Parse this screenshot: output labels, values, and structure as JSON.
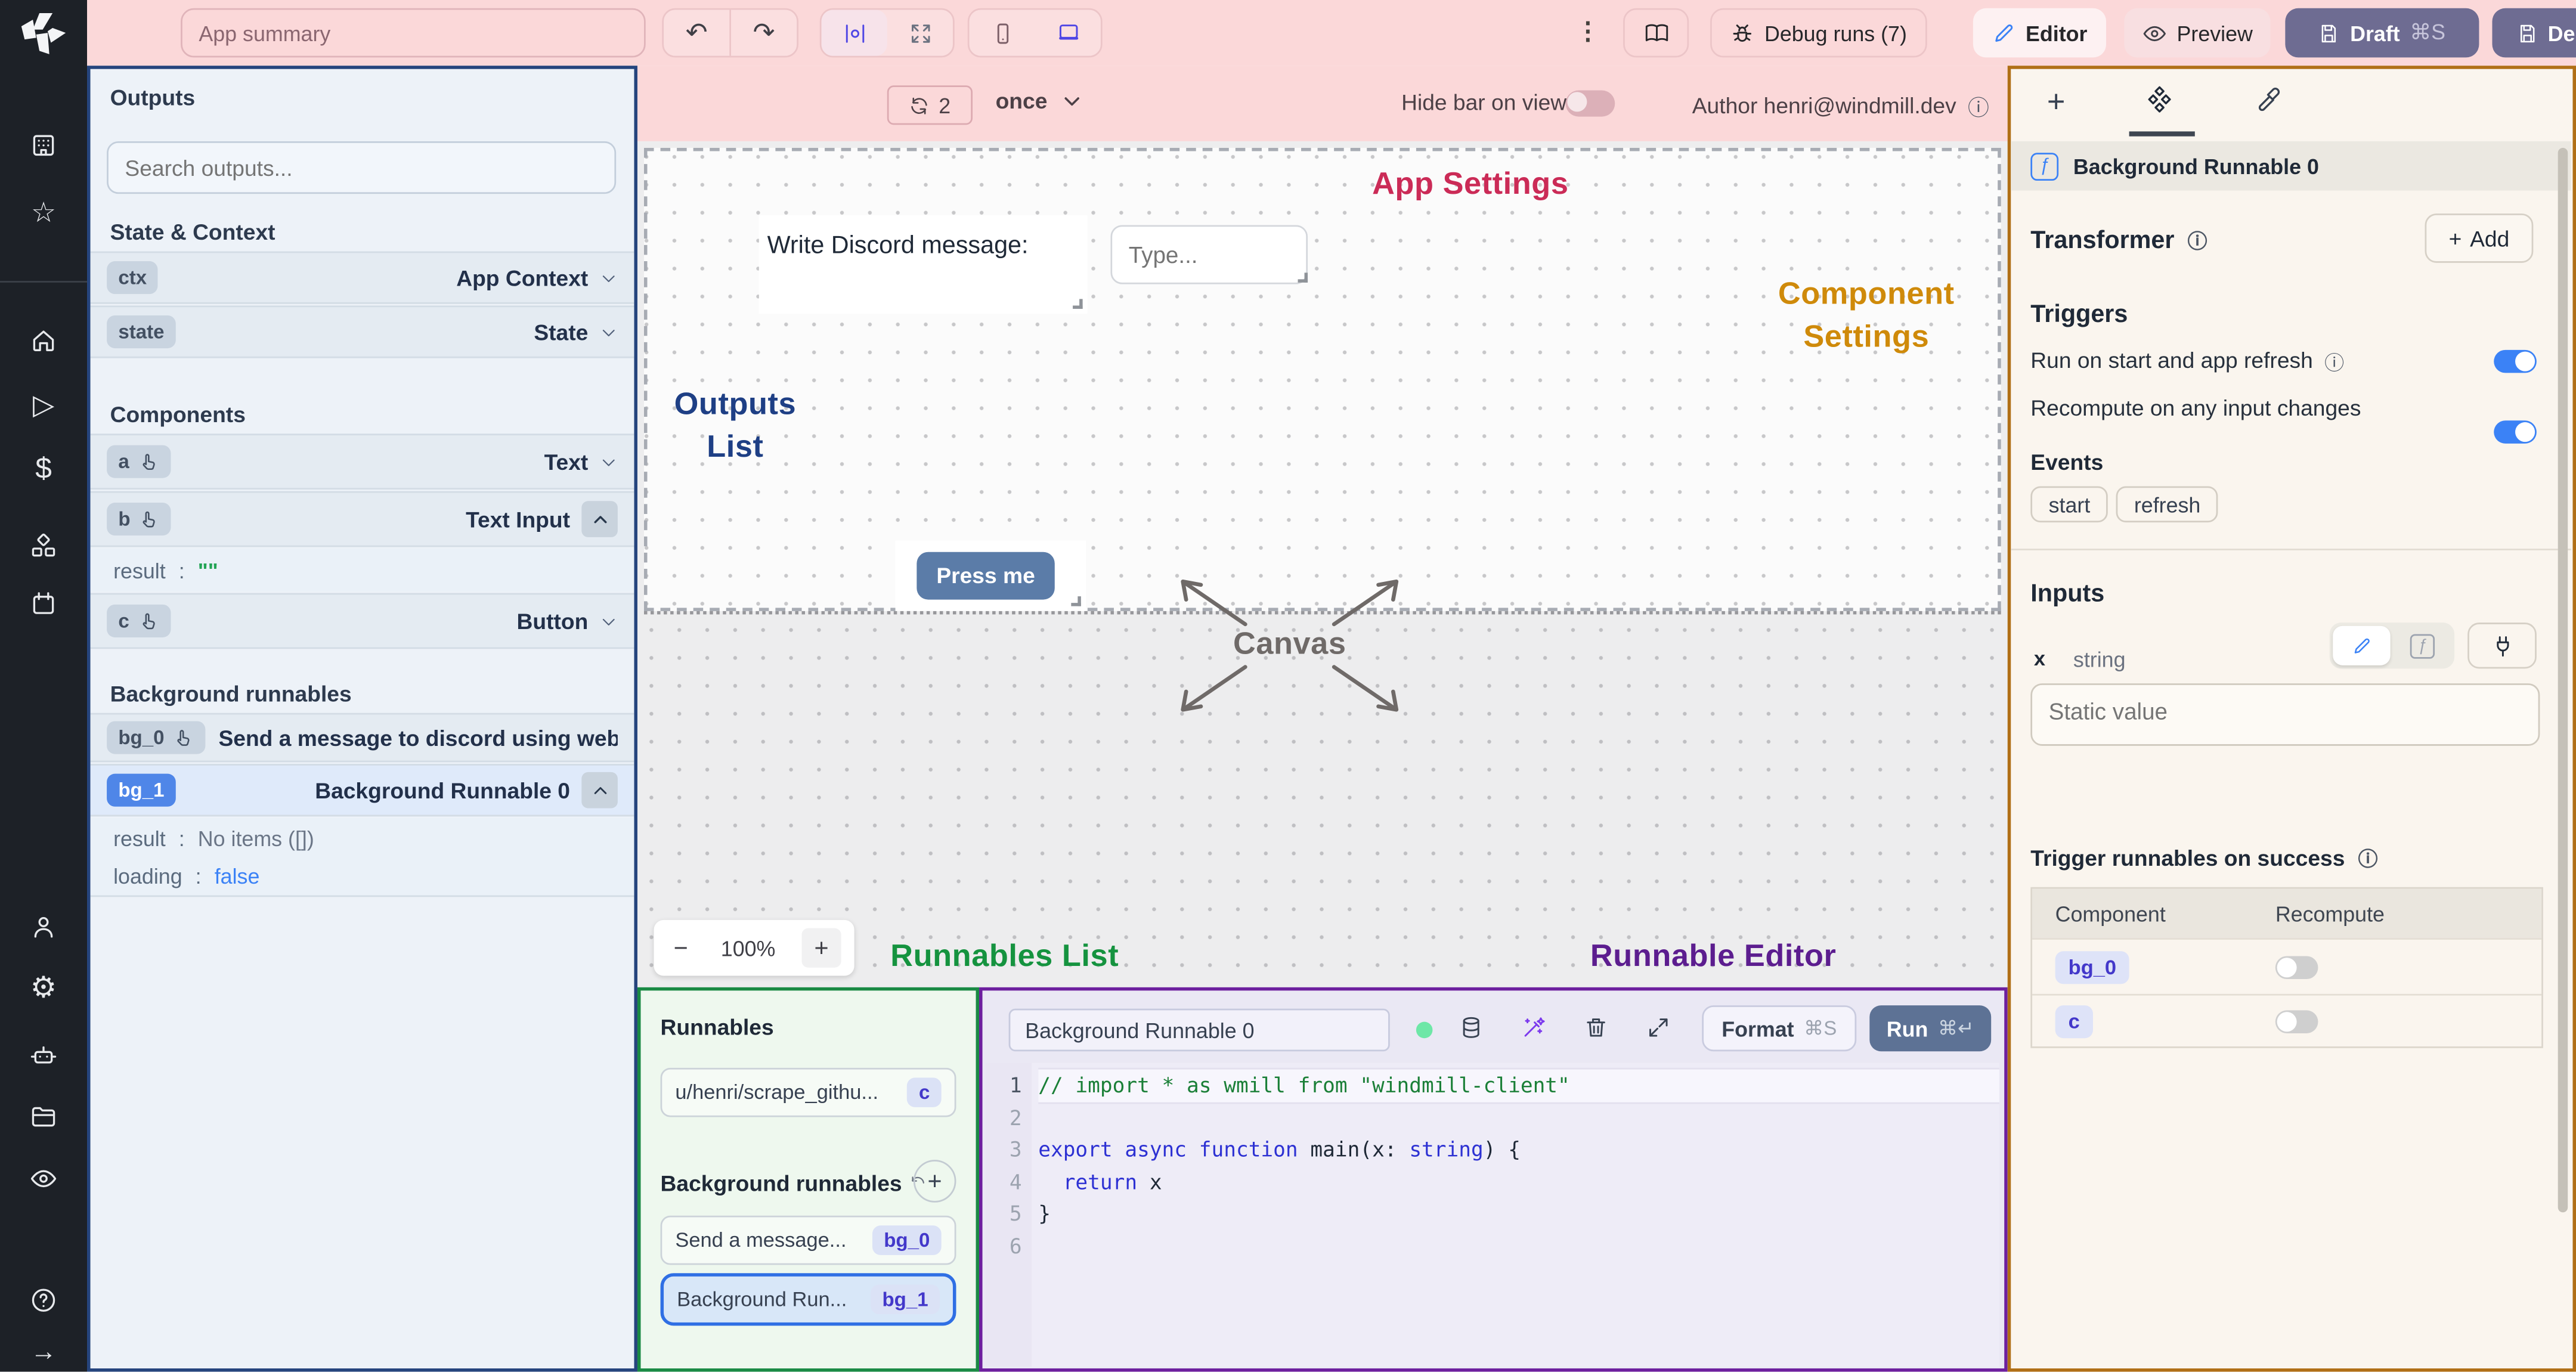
{
  "topbar": {
    "app_summary_placeholder": "App summary",
    "debug_runs_label": "Debug runs (7)",
    "editor_label": "Editor",
    "preview_label": "Preview",
    "draft_label": "Draft",
    "draft_shortcut": "⌘S",
    "deploy_label": "Deploy"
  },
  "canvas_bar": {
    "refresh_count": "2",
    "run_mode": "once",
    "hide_bar_label": "Hide bar on view",
    "author_label": "Author henri@windmill.dev"
  },
  "annotations": {
    "app_settings": "App Settings",
    "component_settings_line1": "Component",
    "component_settings_line2": "Settings",
    "outputs_list_line1": "Outputs",
    "outputs_list_line2": "List",
    "canvas": "Canvas",
    "runnables_list": "Runnables List",
    "runnable_editor": "Runnable Editor"
  },
  "canvas": {
    "discord_label": "Write Discord message:",
    "type_placeholder": "Type...",
    "press_me_label": "Press me",
    "zoom_out": "−",
    "zoom_level": "100%",
    "zoom_in": "+"
  },
  "outputs_panel": {
    "title": "Outputs",
    "search_placeholder": "Search outputs...",
    "state_context_heading": "State & Context",
    "components_heading": "Components",
    "background_heading": "Background runnables",
    "ctx": {
      "id": "ctx",
      "type": "App Context"
    },
    "state": {
      "id": "state",
      "type": "State"
    },
    "a": {
      "id": "a",
      "type": "Text"
    },
    "b": {
      "id": "b",
      "type": "Text Input"
    },
    "b_result": {
      "key": "result",
      "colon": ":",
      "value": "\"\""
    },
    "c": {
      "id": "c",
      "type": "Button"
    },
    "bg0": {
      "id": "bg_0",
      "label": "Send a message to discord using webhoo"
    },
    "bg1": {
      "id": "bg_1",
      "label": "Background Runnable 0"
    },
    "bg1_result": {
      "key": "result",
      "colon": ":",
      "value": "No items ([])"
    },
    "bg1_loading": {
      "key": "loading",
      "colon": ":",
      "value": "false"
    }
  },
  "runnables_panel": {
    "title": "Runnables",
    "item_path": {
      "label": "u/henri/scrape_githu...",
      "badge": "c"
    },
    "background_heading": "Background runnables",
    "item_bg0": {
      "label": "Send a message...",
      "badge": "bg_0"
    },
    "item_bg1": {
      "label": "Background Run...",
      "badge": "bg_1"
    }
  },
  "editor": {
    "name": "Background Runnable 0",
    "format_label": "Format",
    "format_shortcut": "⌘S",
    "run_label": "Run",
    "run_shortcut": "⌘↵",
    "line_numbers": [
      "1",
      "2",
      "3",
      "4",
      "5",
      "6"
    ],
    "code": {
      "l1": "// import * as wmill from \"windmill-client\"",
      "l3a": "export async function ",
      "l3b": "main(x: ",
      "l3c": "string",
      "l3d": ") {",
      "l4a": "  return",
      "l4b": " x",
      "l5": "}"
    }
  },
  "right_panel": {
    "runnable_title": "Background Runnable 0",
    "transformer_heading": "Transformer",
    "add_label": "Add",
    "triggers_heading": "Triggers",
    "run_on_start_label": "Run on start and app refresh",
    "recompute_label": "Recompute on any input changes",
    "events_heading": "Events",
    "event_start": "start",
    "event_refresh": "refresh",
    "inputs_heading": "Inputs",
    "input_name": "x",
    "input_type": "string",
    "static_placeholder": "Static value",
    "trigger_success_heading": "Trigger runnables on success",
    "table": {
      "col_component": "Component",
      "col_recompute": "Recompute",
      "row1_badge": "bg_0",
      "row2_badge": "c"
    }
  },
  "glyphs": {
    "info": "ⓘ",
    "kebab": "⋮",
    "undo": "↶",
    "redo": "↷",
    "dollar": "$",
    "star": "☆",
    "gear": "⚙",
    "play": "▷",
    "arrow_right": "→",
    "question": "?",
    "fx": "ƒ",
    "plus": "+",
    "colon": ":"
  },
  "colors": {
    "topbar_pink": "#fbd8d9",
    "annotation_navy": "#1e3f85",
    "annotation_rose": "#cb2b57",
    "annotation_amber": "#cf8a0a",
    "annotation_green": "#15933f",
    "annotation_purple": "#5c1d8f",
    "toggle_blue": "#3b82f6",
    "deploy_slate": "#6e6c92"
  }
}
